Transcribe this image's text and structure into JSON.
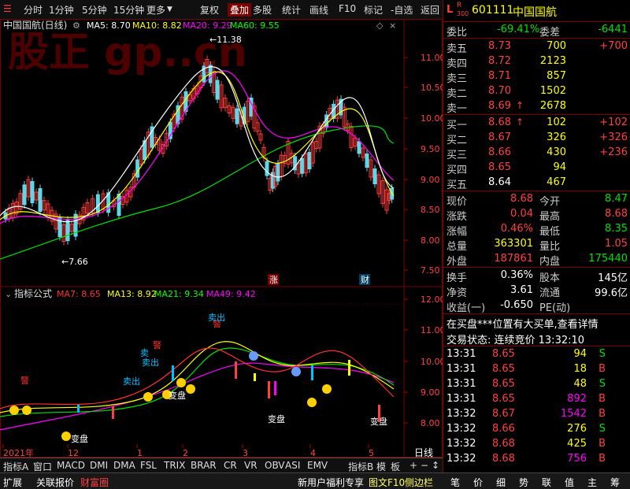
{
  "toolbar": {
    "left_items": [
      "分时",
      "1分钟",
      "5分钟",
      "15分钟",
      "更多"
    ],
    "right_items": [
      "复权",
      "叠加",
      "多股",
      "统计",
      "画线",
      "F10",
      "标记",
      "-自选",
      "返回"
    ],
    "active": "叠加"
  },
  "watermark": "股正  gp..cn",
  "main_chart": {
    "title": "中国国航(日线)",
    "ma_labels": [
      {
        "text": "MA5: 8.70",
        "color": "#ffffff"
      },
      {
        "text": "MA10: 8.82",
        "color": "#ffff00"
      },
      {
        "text": "MA20: 9.29",
        "color": "#ff00ff"
      },
      {
        "text": "MA60: 9.55",
        "color": "#00ff00"
      }
    ],
    "y_ticks": [
      "11.00",
      "10.50",
      "10.00",
      "9.50",
      "9.00",
      "8.50",
      "8.00",
      "7.50"
    ],
    "high_label": "11.38",
    "low_label": "7.66",
    "badges": [
      "涨",
      "财"
    ]
  },
  "indicator_chart": {
    "title": "指标公式",
    "ma_labels": [
      {
        "text": "MA7: 8.65",
        "color": "#ff3030"
      },
      {
        "text": "MA13: 8.92",
        "color": "#ffff00"
      },
      {
        "text": "MA21: 9.34",
        "color": "#00ff00"
      },
      {
        "text": "MA49: 9.42",
        "color": "#ff00ff"
      }
    ],
    "y_ticks": [
      "12.00",
      "11.00",
      "10.00",
      "9.00",
      "8.00"
    ],
    "annotations": [
      "变盘",
      "变盘",
      "变盘",
      "变盘",
      "警",
      "警",
      "警",
      "卖出",
      "卖出",
      "卖出",
      "卖"
    ]
  },
  "x_axis": {
    "labels": [
      "2021年",
      "12",
      "1",
      "2",
      "3",
      "4",
      "5"
    ],
    "period": "日线"
  },
  "tabs": [
    "指标A",
    "窗口",
    "MACD",
    "DMI",
    "DMA",
    "FSL",
    "TRIX",
    "BRAR",
    "CR",
    "VR",
    "OBV",
    "ASI",
    "EMV",
    "指标B",
    "模",
    "板"
  ],
  "status_bar": {
    "left": [
      "扩展",
      "关联报价",
      "财富圈"
    ],
    "right": [
      "新用户福利专享",
      "图文F10",
      "侧边栏"
    ],
    "icons": [
      "笔",
      "价",
      "细",
      "势",
      "联",
      "值",
      "主",
      "筹"
    ]
  },
  "quote": {
    "code": "601111",
    "name": "中国国航",
    "weibi_label": "委比",
    "weibi": "-69.41%",
    "weicha_label": "委差",
    "weicha": "-6441",
    "asks": [
      {
        "label": "卖五",
        "price": "8.73",
        "vol": "700",
        "chg": "+700"
      },
      {
        "label": "卖四",
        "price": "8.72",
        "vol": "2123",
        "chg": ""
      },
      {
        "label": "卖三",
        "price": "8.71",
        "vol": "857",
        "chg": ""
      },
      {
        "label": "卖二",
        "price": "8.70",
        "vol": "1502",
        "chg": ""
      },
      {
        "label": "卖一",
        "price": "8.69",
        "vol": "2678",
        "chg": ""
      }
    ],
    "bids": [
      {
        "label": "买一",
        "price": "8.68",
        "vol": "102",
        "chg": "+102"
      },
      {
        "label": "买二",
        "price": "8.67",
        "vol": "326",
        "chg": "+326"
      },
      {
        "label": "买三",
        "price": "8.66",
        "vol": "430",
        "chg": "+236"
      },
      {
        "label": "买四",
        "price": "8.65",
        "vol": "94",
        "chg": ""
      },
      {
        "label": "买五",
        "price": "8.64",
        "vol": "467",
        "chg": ""
      }
    ],
    "stats": [
      {
        "l1": "现价",
        "v1": "8.68",
        "l2": "今开",
        "v2": "8.47"
      },
      {
        "l1": "涨跌",
        "v1": "0.04",
        "l2": "最高",
        "v2": "8.68"
      },
      {
        "l1": "涨幅",
        "v1": "0.46%",
        "l2": "最低",
        "v2": "8.35"
      },
      {
        "l1": "总量",
        "v1": "363301",
        "l2": "量比",
        "v2": "1.05"
      },
      {
        "l1": "外盘",
        "v1": "187861",
        "l2": "内盘",
        "v2": "175440"
      }
    ],
    "stats2": [
      {
        "l1": "换手",
        "v1": "0.36%",
        "l2": "股本",
        "v2": "145亿"
      },
      {
        "l1": "净资",
        "v1": "3.61",
        "l2": "流通",
        "v2": "99.6亿"
      },
      {
        "l1": "收益(一)",
        "v1": "-0.650",
        "l2": "PE(动)",
        "v2": ""
      }
    ],
    "notice": "在买盘***位置有大买单,查看详情",
    "status_text": "交易状态: 连续竞价 13:32:10",
    "trades": [
      {
        "t": "13:31",
        "p": "8.65",
        "v": "94",
        "d": "S"
      },
      {
        "t": "13:31",
        "p": "8.65",
        "v": "18",
        "d": "B"
      },
      {
        "t": "13:31",
        "p": "8.65",
        "v": "48",
        "d": "S"
      },
      {
        "t": "13:31",
        "p": "8.65",
        "v": "892",
        "d": "B"
      },
      {
        "t": "13:32",
        "p": "8.67",
        "v": "1542",
        "d": "B"
      },
      {
        "t": "13:32",
        "p": "8.66",
        "v": "276",
        "d": "S"
      },
      {
        "t": "13:32",
        "p": "8.68",
        "v": "425",
        "d": "B"
      },
      {
        "t": "13:32",
        "p": "8.68",
        "v": "756",
        "d": "B"
      }
    ]
  }
}
